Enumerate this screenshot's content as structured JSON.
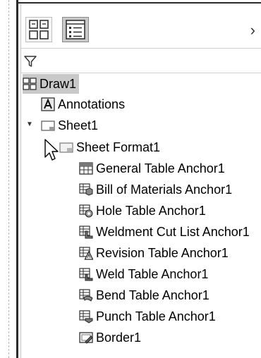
{
  "toolbar": {
    "buttons": [
      {
        "name": "DrawingView1 panel",
        "icon": "view-layout-icon"
      },
      {
        "name": "Feature tree panel",
        "icon": "tree-list-icon",
        "active": true
      }
    ],
    "more_icon": "chevron-right-icon"
  },
  "filter": {
    "icon": "filter-icon"
  },
  "tree": {
    "root": {
      "label": "Draw1",
      "icon": "drawing-icon"
    },
    "annotations": {
      "label": "Annotations",
      "icon": "annotation-icon"
    },
    "sheet": {
      "label": "Sheet1",
      "icon": "sheet-icon",
      "expanded": true
    },
    "sheet_format": {
      "label": "Sheet Format1",
      "icon": "sheet-format-icon",
      "expanded": true
    },
    "anchors": [
      {
        "label": "General Table Anchor1",
        "icon": "general-table-icon"
      },
      {
        "label": "Bill of Materials Anchor1",
        "icon": "bom-icon"
      },
      {
        "label": "Hole Table Anchor1",
        "icon": "hole-table-icon"
      },
      {
        "label": "Weldment Cut List Anchor1",
        "icon": "weldment-icon"
      },
      {
        "label": "Revision Table Anchor1",
        "icon": "revision-icon"
      },
      {
        "label": "Weld Table Anchor1",
        "icon": "weld-table-icon"
      },
      {
        "label": "Bend Table Anchor1",
        "icon": "bend-table-icon"
      },
      {
        "label": "Punch Table Anchor1",
        "icon": "punch-table-icon"
      }
    ],
    "border": {
      "label": "Border1",
      "icon": "border-icon"
    }
  }
}
